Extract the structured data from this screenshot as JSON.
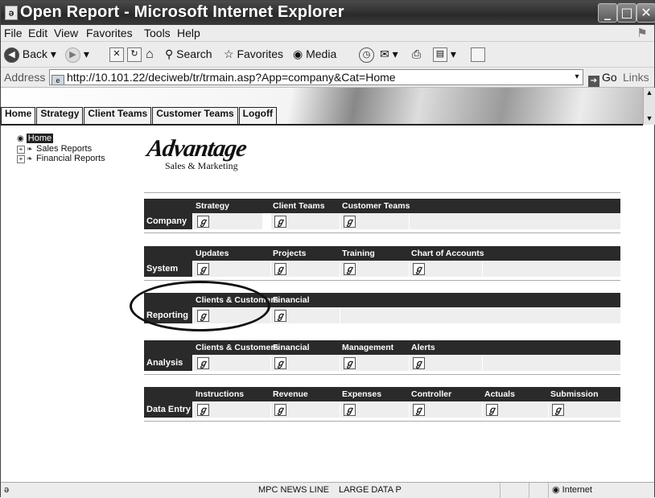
{
  "window": {
    "title": "Open Report - Microsoft Internet Explorer",
    "doc_icon": "ie-document-icon"
  },
  "menu": [
    "File",
    "Edit",
    "View",
    "Favorites",
    "Tools",
    "Help"
  ],
  "toolbar": {
    "back": "Back",
    "search": "Search",
    "favorites": "Favorites",
    "media": "Media"
  },
  "address": {
    "label": "Address",
    "url": "http://10.101.22/deciweb/tr/trmain.asp?App=company&Cat=Home",
    "go": "Go",
    "links": "Links"
  },
  "nav_tabs": [
    "Home",
    "Strategy",
    "Client Teams",
    "Customer Teams",
    "Logoff"
  ],
  "tree": {
    "home": "Home",
    "items": [
      "Sales Reports",
      "Financial Reports"
    ]
  },
  "logo": {
    "name": "Advantage",
    "tagline": "Sales & Marketing"
  },
  "sections": [
    {
      "label": "Company",
      "items": [
        "Strategy",
        "Client Teams",
        "Customer Teams"
      ]
    },
    {
      "label": "System",
      "items": [
        "Updates",
        "Projects",
        "Training",
        "Chart of Accounts"
      ]
    },
    {
      "label": "Reporting",
      "items": [
        "Clients & Customers",
        "Financial"
      ]
    },
    {
      "label": "Analysis",
      "items": [
        "Clients & Customers",
        "Financial",
        "Management",
        "Alerts"
      ]
    },
    {
      "label": "Data Entry",
      "items": [
        "Instructions",
        "Revenue",
        "Expenses",
        "Controller",
        "Actuals",
        "Submission"
      ]
    }
  ],
  "status": {
    "zone1": "MPC NEWS LINE",
    "zone2": "LARGE DATA P",
    "zone3": "Internet"
  }
}
